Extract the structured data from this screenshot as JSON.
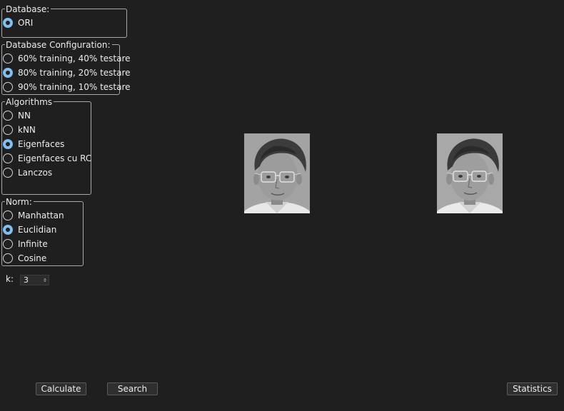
{
  "database": {
    "title": "Database:",
    "options": [
      {
        "label": "ORI",
        "checked": true
      }
    ]
  },
  "db_config": {
    "title": "Database Configuration:",
    "options": [
      {
        "label": "60% training, 40% testare",
        "checked": false
      },
      {
        "label": "80% training, 20% testare",
        "checked": true
      },
      {
        "label": "90% training, 10% testare",
        "checked": false
      }
    ]
  },
  "algorithms": {
    "title": "Algorithms",
    "options": [
      {
        "label": "NN",
        "checked": false
      },
      {
        "label": "kNN",
        "checked": false
      },
      {
        "label": "Eigenfaces",
        "checked": true
      },
      {
        "label": "Eigenfaces cu RC",
        "checked": false
      },
      {
        "label": "Lanczos",
        "checked": false
      }
    ]
  },
  "norm": {
    "title": "Norm:",
    "options": [
      {
        "label": "Manhattan",
        "checked": false
      },
      {
        "label": "Euclidian",
        "checked": true
      },
      {
        "label": "Infinite",
        "checked": false
      },
      {
        "label": "Cosine",
        "checked": false
      }
    ]
  },
  "k_field": {
    "label": "k:",
    "value": "3"
  },
  "buttons": {
    "calculate": "Calculate",
    "search": "Search",
    "statistics": "Statistics"
  },
  "colors": {
    "background": "#1f1f1f",
    "radio_accent": "#7fc0f0",
    "border": "#a8a8a8"
  }
}
